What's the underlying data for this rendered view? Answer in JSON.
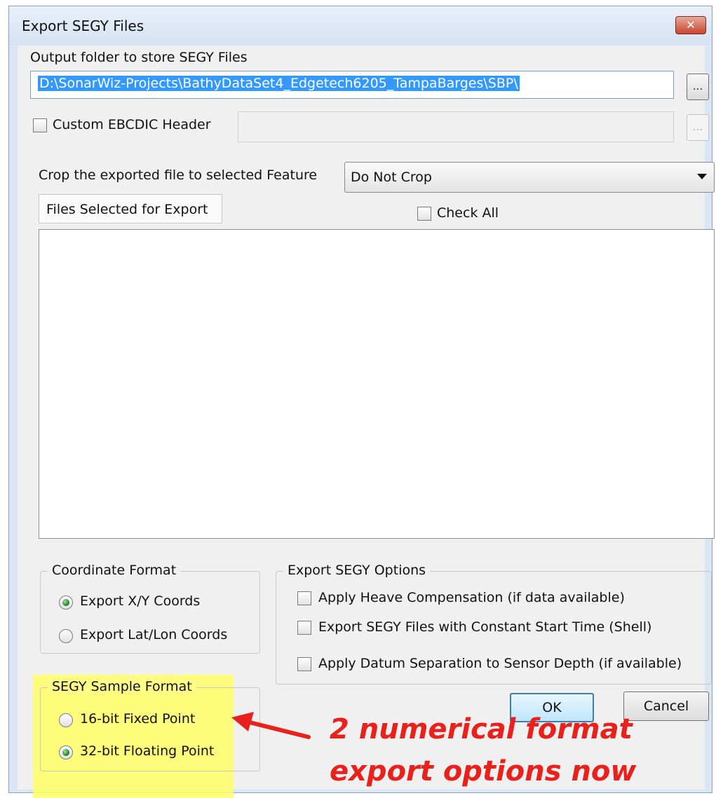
{
  "window": {
    "title": "Export SEGY Files",
    "close_label": "✕"
  },
  "output": {
    "label": "Output folder to store SEGY Files",
    "path": "D:\\SonarWiz-Projects\\BathyDataSet4_Edgetech6205_TampaBarges\\SBP\\",
    "browse_label": "..."
  },
  "ebcdic": {
    "label": "Custom EBCDIC Header",
    "checked": false,
    "browse_label": "..."
  },
  "crop": {
    "label": "Crop the exported file to selected Feature",
    "selected": "Do Not Crop"
  },
  "files": {
    "tab_label": "Files Selected for Export",
    "check_all_label": "Check All",
    "items": []
  },
  "coordinate_format": {
    "title": "Coordinate Format",
    "options": [
      {
        "label": "Export X/Y Coords",
        "checked": true
      },
      {
        "label": "Export Lat/Lon Coords",
        "checked": false
      }
    ]
  },
  "segy_options": {
    "title": "Export SEGY Options",
    "items": [
      {
        "label": "Apply Heave Compensation (if data available)",
        "checked": false
      },
      {
        "label": "Export SEGY Files with Constant Start Time (Shell)",
        "checked": false
      },
      {
        "label": "Apply Datum Separation to Sensor Depth (if available)",
        "checked": false
      }
    ]
  },
  "sample_format": {
    "title": "SEGY Sample Format",
    "options": [
      {
        "label": "16-bit Fixed Point",
        "checked": false
      },
      {
        "label": "32-bit Floating Point",
        "checked": true
      }
    ]
  },
  "buttons": {
    "ok": "OK",
    "cancel": "Cancel"
  },
  "annotation": {
    "line1": "2 numerical format",
    "line2": "export options now",
    "color": "#e8211c"
  },
  "colors": {
    "highlight": "#ffff66",
    "selection": "#3399ff"
  }
}
